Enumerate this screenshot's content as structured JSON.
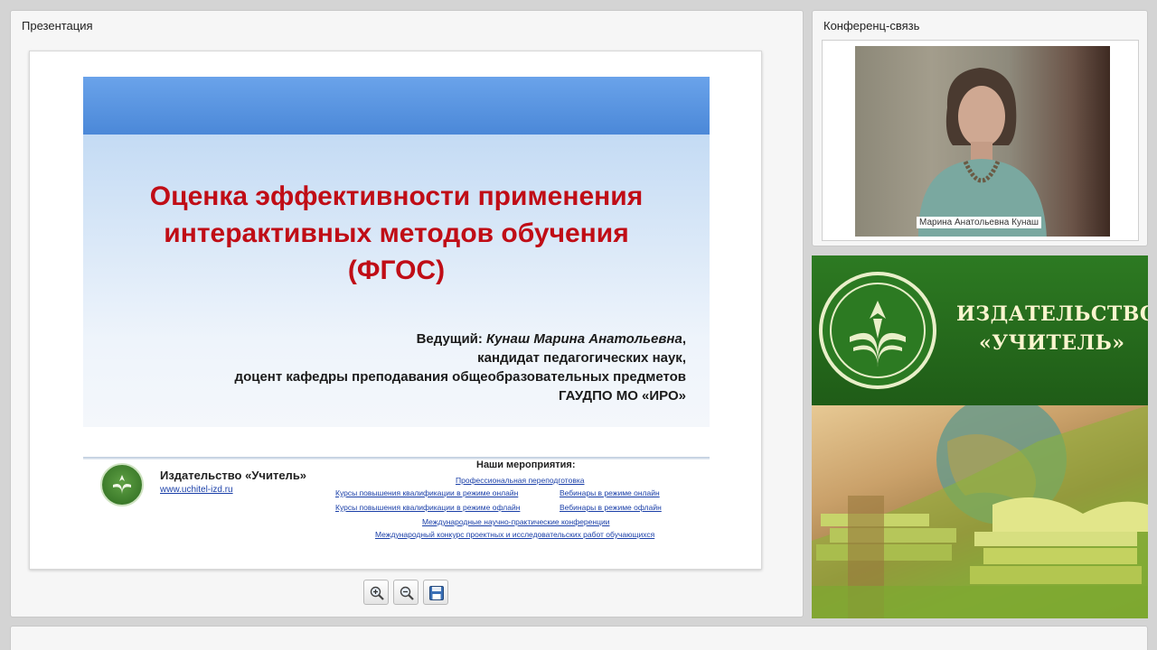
{
  "presentation": {
    "panel_title": "Презентация",
    "slide": {
      "title_lines": [
        "Оценка эффективности применения",
        "интерактивных методов обучения",
        "(ФГОС)"
      ],
      "presenter_label": "Ведущий: ",
      "presenter_name": "Кунаш Марина Анатольевна",
      "presenter_name_suffix": ",",
      "presenter_degree": "кандидат педагогических наук,",
      "presenter_position": "доцент кафедры преподавания общеобразовательных предметов",
      "presenter_org": "ГАУДПО МО «ИРО»",
      "footer": {
        "org_name": "Издательство «Учитель»",
        "url": "www.uchitel-izd.ru",
        "events_title": "Наши мероприятия:",
        "links": [
          "Профессиональная переподготовка",
          "Курсы повышения квалификации в режиме онлайн",
          "Вебинары в режиме онлайн",
          "Курсы повышения квалификации в режиме офлайн",
          "Вебинары в режиме офлайн",
          "Международные научно-практические конференции",
          "Международный конкурс проектных и исследовательских работ обучающихся"
        ]
      }
    },
    "toolbar": {
      "zoom_in_icon": "zoom-in-icon",
      "zoom_out_icon": "zoom-out-icon",
      "save_icon": "save-icon"
    }
  },
  "conference": {
    "panel_title": "Конференц-связь",
    "participant_name": "Марина Анатольевна Кунаш"
  },
  "banner": {
    "line1": "ИЗДАТЕЛЬСТВО",
    "line2": "«УЧИТЕЛЬ»"
  },
  "colors": {
    "slide_title": "#c00d16",
    "link": "#1a3fa8",
    "banner_green": "#2d7a22",
    "banner_text": "#fbf5cf"
  }
}
